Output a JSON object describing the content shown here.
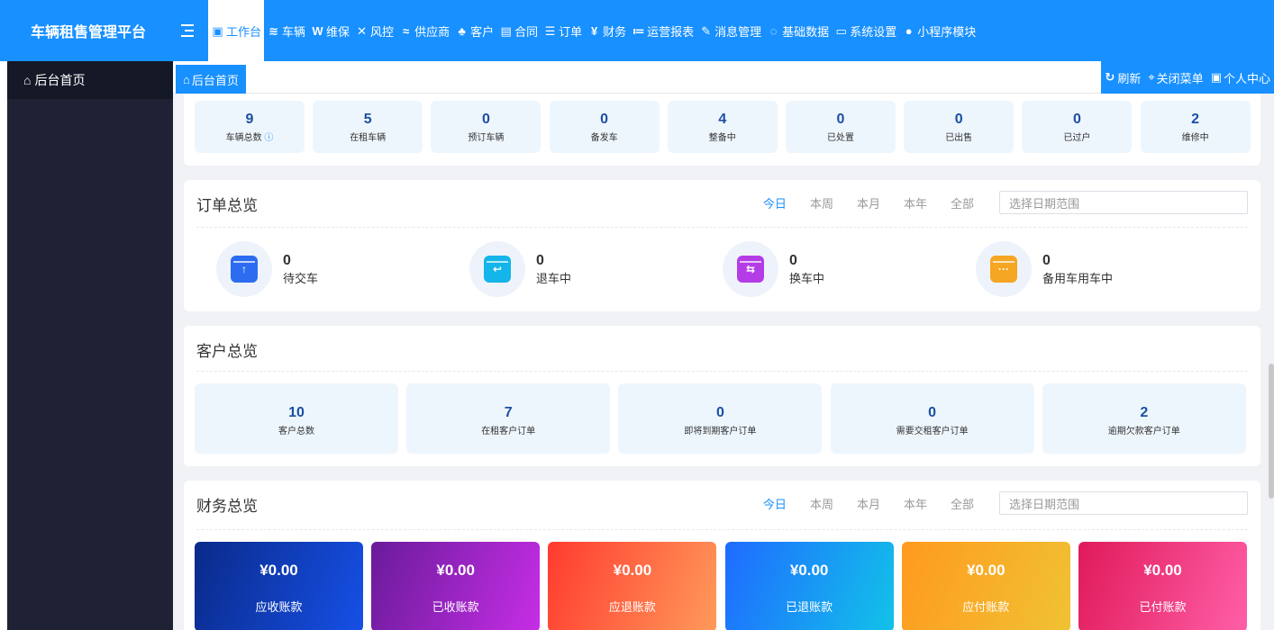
{
  "brand": "车辆租售管理平台",
  "topnav": [
    {
      "label": "工作台",
      "icon": "dashboard-icon",
      "active": true
    },
    {
      "label": "车辆",
      "icon": "layers-icon"
    },
    {
      "label": "维保",
      "icon": "word-doc-icon"
    },
    {
      "label": "风控",
      "icon": "tools-icon"
    },
    {
      "label": "供应商",
      "icon": "stack-icon"
    },
    {
      "label": "客户",
      "icon": "users-icon"
    },
    {
      "label": "合同",
      "icon": "document-icon"
    },
    {
      "label": "订单",
      "icon": "list-icon"
    },
    {
      "label": "财务",
      "icon": "yen-coin-icon"
    },
    {
      "label": "运营报表",
      "icon": "bullet-list-icon"
    },
    {
      "label": "消息管理",
      "icon": "edit-icon"
    },
    {
      "label": "基础数据",
      "icon": "refresh-icon"
    },
    {
      "label": "系统设置",
      "icon": "monitor-settings-icon"
    },
    {
      "label": "小程序模块",
      "icon": "chat-icon"
    }
  ],
  "sidebar": {
    "home": "后台首页"
  },
  "tabs": {
    "home": "后台首页",
    "refresh": "刷新",
    "close_menu": "关闭菜单",
    "profile": "个人中心"
  },
  "vehicle_stats": [
    {
      "value": "9",
      "label": "车辆总数"
    },
    {
      "value": "5",
      "label": "在租车辆"
    },
    {
      "value": "0",
      "label": "预订车辆"
    },
    {
      "value": "0",
      "label": "备发车"
    },
    {
      "value": "4",
      "label": "整备中"
    },
    {
      "value": "0",
      "label": "已处置"
    },
    {
      "value": "0",
      "label": "已出售"
    },
    {
      "value": "0",
      "label": "已过户"
    },
    {
      "value": "2",
      "label": "维修中"
    }
  ],
  "order_overview": {
    "title": "订单总览",
    "filters": [
      "今日",
      "本周",
      "本月",
      "本年",
      "全部"
    ],
    "date_placeholder": "选择日期范围",
    "items": [
      {
        "value": "0",
        "label": "待交车",
        "color": "#2b6cf0",
        "glyph": "↑"
      },
      {
        "value": "0",
        "label": "退车中",
        "color": "#13b5ea",
        "glyph": "↩"
      },
      {
        "value": "0",
        "label": "换车中",
        "color": "#b43ce6",
        "glyph": "⇆"
      },
      {
        "value": "0",
        "label": "备用车用车中",
        "color": "#f5a623",
        "glyph": "···"
      }
    ]
  },
  "customer_overview": {
    "title": "客户总览",
    "items": [
      {
        "value": "10",
        "label": "客户总数"
      },
      {
        "value": "7",
        "label": "在租客户订单"
      },
      {
        "value": "0",
        "label": "即将到期客户订单"
      },
      {
        "value": "0",
        "label": "需要交租客户订单"
      },
      {
        "value": "2",
        "label": "逾期欠款客户订单"
      }
    ]
  },
  "finance_overview": {
    "title": "财务总览",
    "filters": [
      "今日",
      "本周",
      "本月",
      "本年",
      "全部"
    ],
    "date_placeholder": "选择日期范围",
    "items": [
      {
        "value": "¥0.00",
        "label": "应收账款",
        "gradient": [
          "#0a2a8a",
          "#1650e6"
        ]
      },
      {
        "value": "¥0.00",
        "label": "已收账款",
        "gradient": [
          "#6a1b9a",
          "#c62ee6"
        ]
      },
      {
        "value": "¥0.00",
        "label": "应退账款",
        "gradient": [
          "#ff3b2f",
          "#ff9a5a"
        ]
      },
      {
        "value": "¥0.00",
        "label": "已退账款",
        "gradient": [
          "#1f6bff",
          "#12c2e9"
        ]
      },
      {
        "value": "¥0.00",
        "label": "应付账款",
        "gradient": [
          "#ff9a1f",
          "#f0c233"
        ]
      },
      {
        "value": "¥0.00",
        "label": "已付账款",
        "gradient": [
          "#e01a5a",
          "#ff5fa8"
        ]
      }
    ]
  }
}
